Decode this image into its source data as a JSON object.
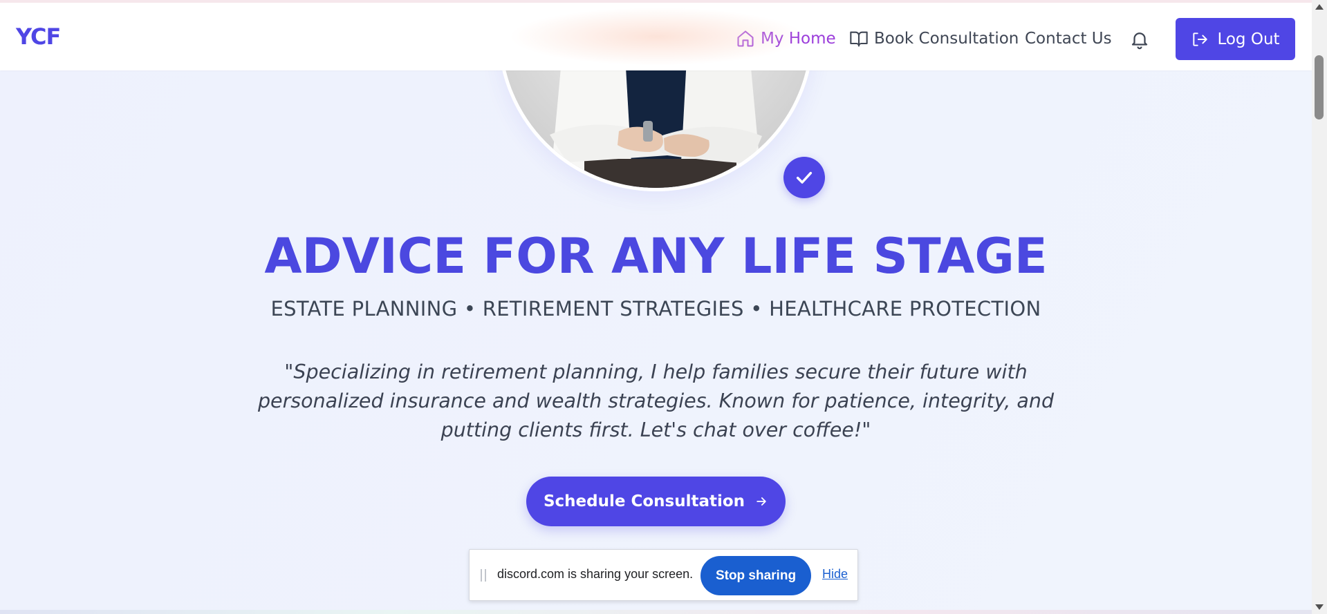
{
  "header": {
    "logo": "YCF",
    "nav": {
      "home": "My Home",
      "book": "Book Consultation",
      "contact": "Contact Us"
    },
    "logout_label": "Log Out",
    "active_color": "#9b3ddb",
    "accent_color": "#4f46e5"
  },
  "hero": {
    "headline": "ADVICE FOR ANY LIFE STAGE",
    "subline": "ESTATE PLANNING • RETIREMENT STRATEGIES • HEALTHCARE PROTECTION",
    "quote": "\"Specializing in retirement planning, I help families secure their future with personalized insurance and wealth strategies. Known for patience, integrity, and putting clients first. Let's chat over coffee!\"",
    "cta_label": "Schedule Consultation"
  },
  "share_bar": {
    "message": "discord.com is sharing your screen.",
    "stop_label": "Stop sharing",
    "hide_label": "Hide"
  },
  "icons": [
    "home-icon",
    "book-icon",
    "bell-icon",
    "logout-icon",
    "check-icon",
    "arrow-right-icon"
  ]
}
